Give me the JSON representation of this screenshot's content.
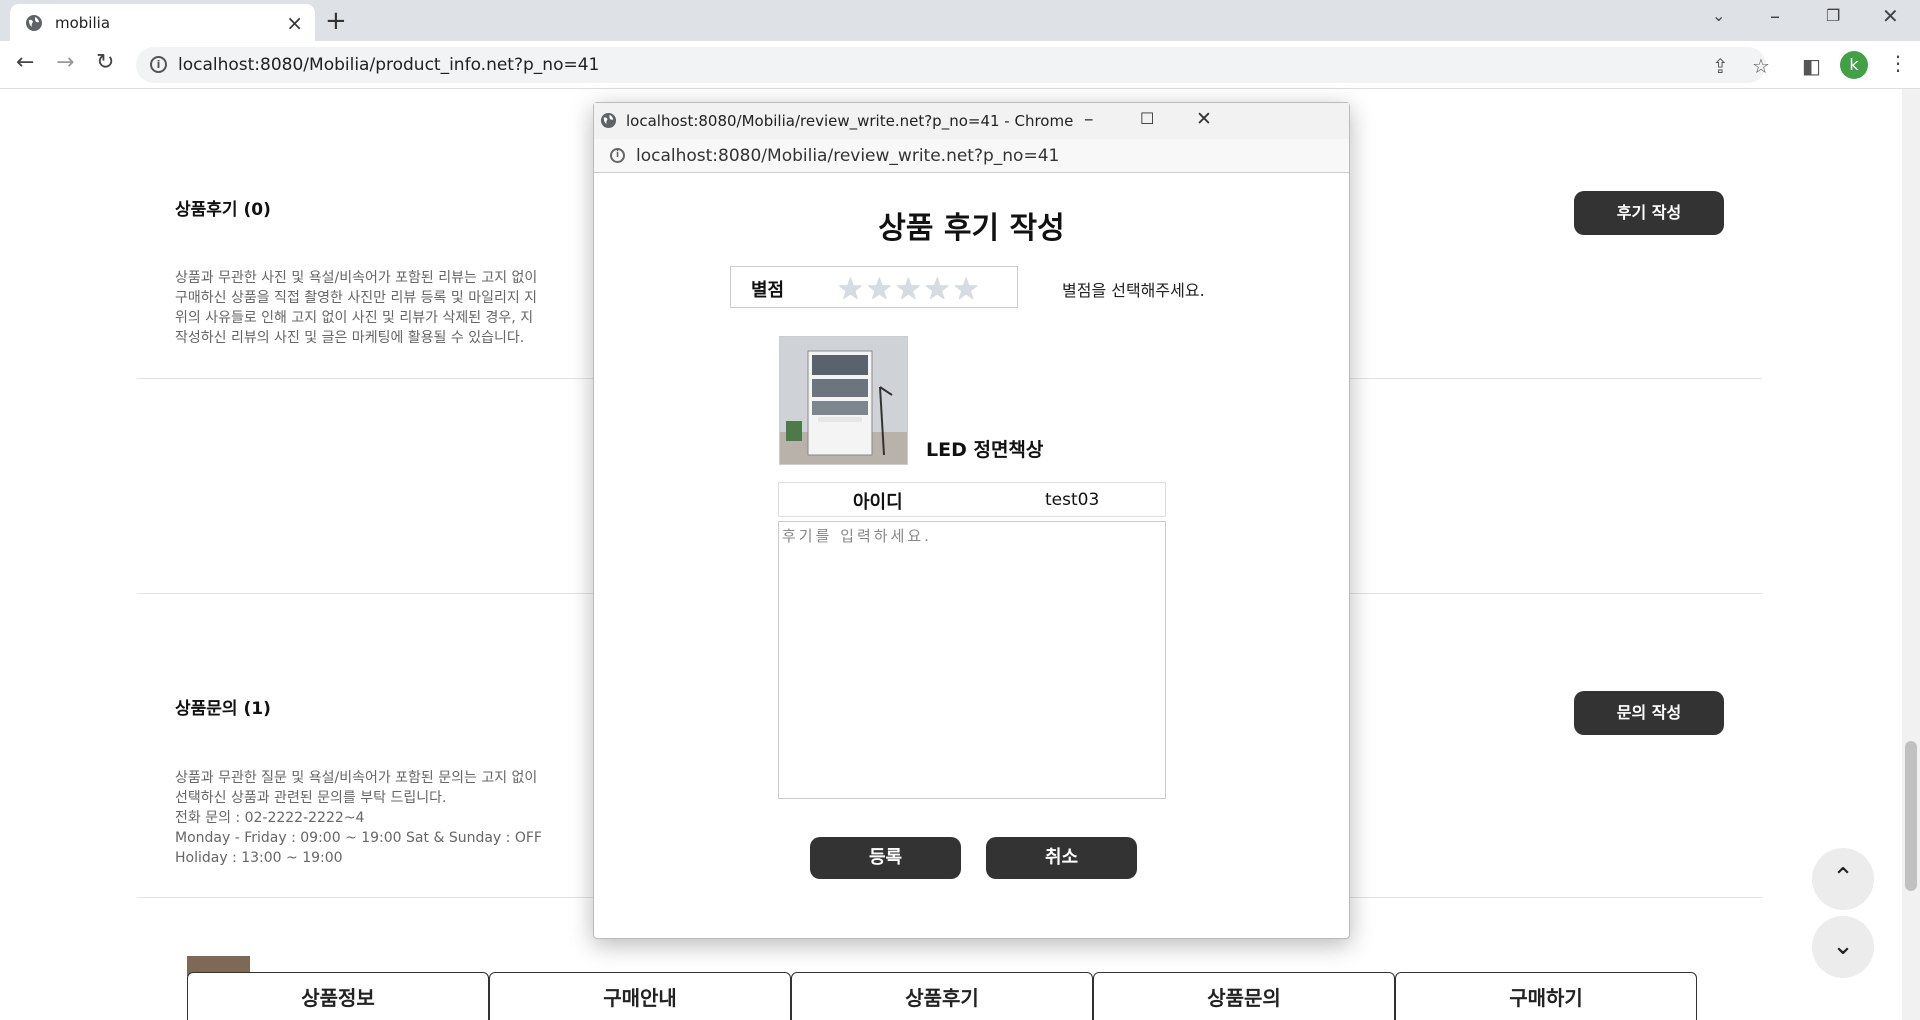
{
  "browser": {
    "tab_title": "mobilia",
    "url": "localhost:8080/Mobilia/product_info.net?p_no=41",
    "profile_initial": "k"
  },
  "page": {
    "review_section": {
      "title": "상품후기",
      "count": "(0)",
      "button": "후기 작성",
      "notice_lines": [
        "상품과 무관한 사진 및 욕설/비속어가 포함된 리뷰는 고지 없이",
        "구매하신 상품을 직접 촬영한 사진만 리뷰 등록 및 마일리지 지",
        "위의 사유들로 인해 고지 없이 사진 및 리뷰가 삭제된 경우, 지",
        "작성하신 리뷰의 사진 및 글은 마케팅에 활용될 수 있습니다."
      ]
    },
    "inquiry_section": {
      "title": "상품문의",
      "count": "(1)",
      "button": "문의 작성",
      "notice_lines": [
        "상품과 무관한 질문 및 욕설/비속어가 포함된 문의는 고지 없이",
        "선택하신 상품과 관련된 문의를 부탁 드립니다.",
        "전화 문의 : 02-2222-2222~4",
        "Monday - Friday : 09:00 ~ 19:00 Sat & Sunday : OFF",
        "Holiday : 13:00 ~ 19:00"
      ]
    },
    "bottom_nav": [
      "상품정보",
      "구매안내",
      "상품후기",
      "상품문의",
      "구매하기"
    ]
  },
  "popup": {
    "window_title": "localhost:8080/Mobilia/review_write.net?p_no=41 - Chrome",
    "url": "localhost:8080/Mobilia/review_write.net?p_no=41",
    "heading": "상품 후기 작성",
    "rating_label": "별점",
    "rating_value": 0,
    "rating_max": 5,
    "rating_hint": "별점을 선택해주세요.",
    "product_name": "LED 정면책상",
    "id_label": "아이디",
    "id_value": "test03",
    "review_placeholder": "후기를 입력하세요.",
    "submit_button": "등록",
    "cancel_button": "취소"
  }
}
